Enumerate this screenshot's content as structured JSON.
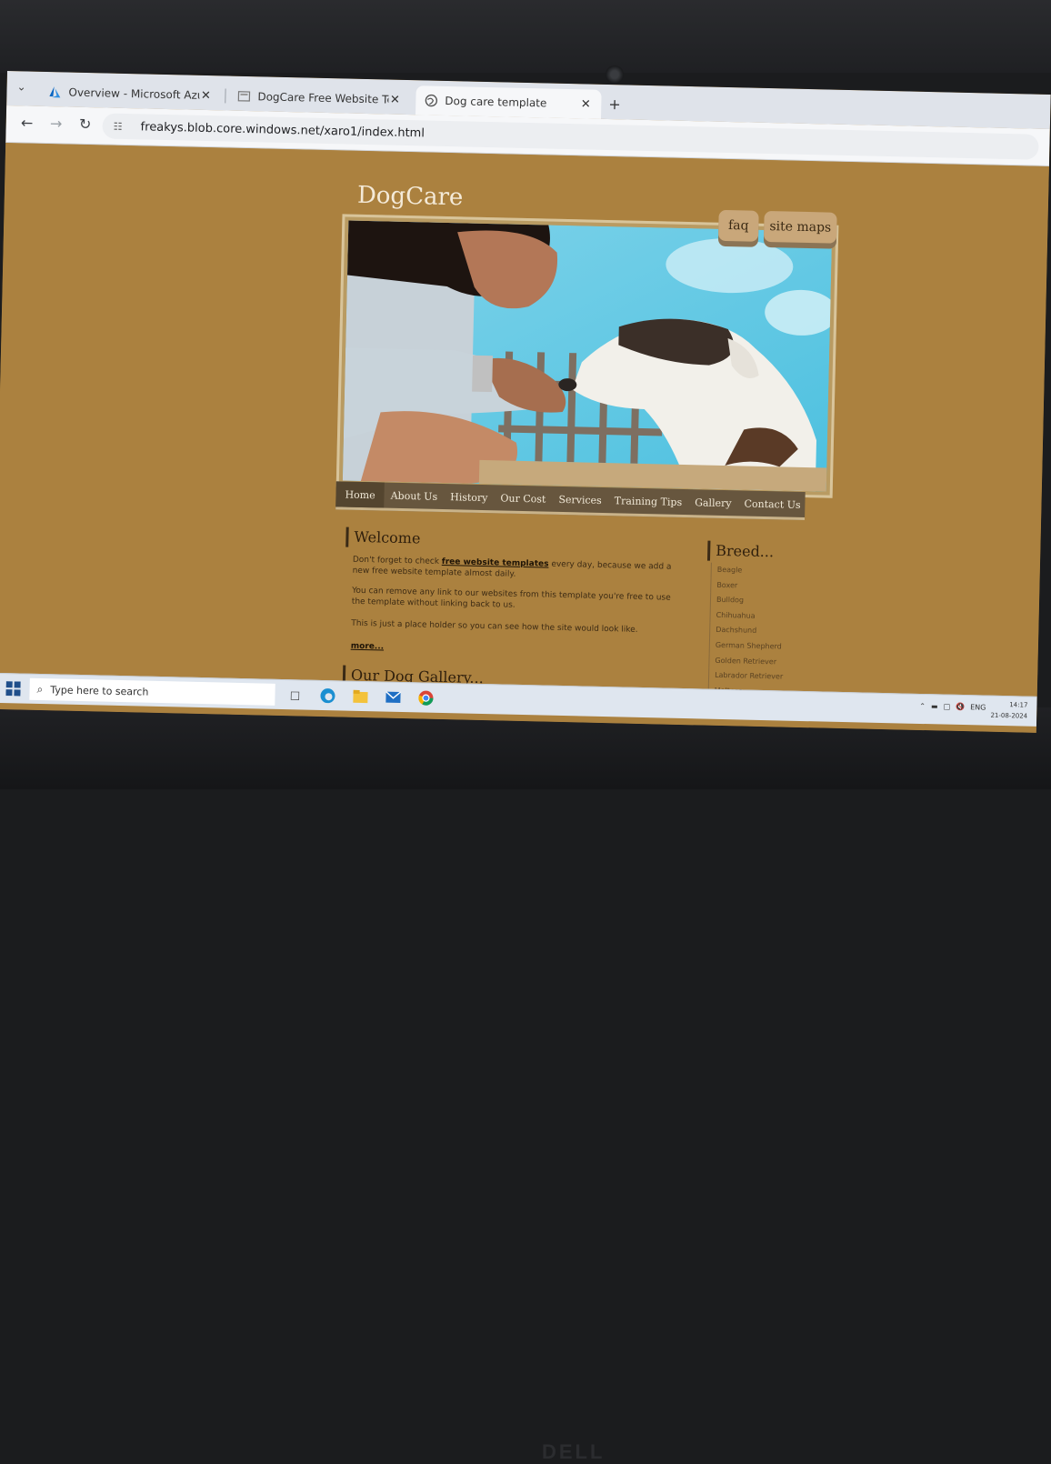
{
  "browser": {
    "tabs": [
      {
        "title": "Overview - Microsoft Azure",
        "icon": "azure-icon"
      },
      {
        "title": "DogCare Free Website Templat",
        "icon": "page-icon"
      },
      {
        "title": "Dog care template",
        "icon": "globe-icon"
      }
    ],
    "url": "freakys.blob.core.windows.net/xaro1/index.html"
  },
  "site": {
    "title": "DogCare",
    "top_links": [
      "faq",
      "site maps"
    ],
    "nav": [
      "Home",
      "About Us",
      "History",
      "Our Cost",
      "Services",
      "Training Tips",
      "Gallery",
      "Contact Us"
    ],
    "welcome": {
      "heading": "Welcome",
      "p1_before": "Don't forget to check ",
      "p1_link": "free website templates",
      "p1_after": " every day, because we add a new free website template almost daily.",
      "p2": "You can remove any link to our websites from this template you're free to use the template without linking back to us.",
      "p3": "This is just a place holder so you can see how the site would look like.",
      "more": "more..."
    },
    "gallery_heading": "Our Dog Gallery...",
    "breed": {
      "heading": "Breed...",
      "items": [
        "Beagle",
        "Boxer",
        "Bulldog",
        "Chihuahua",
        "Dachshund",
        "German Shepherd",
        "Golden Retriever",
        "Labrador Retriever",
        "Maltese"
      ]
    }
  },
  "taskbar": {
    "search_placeholder": "Type here to search",
    "lang": "ENG",
    "time": "14:17",
    "date": "21-08-2024"
  }
}
